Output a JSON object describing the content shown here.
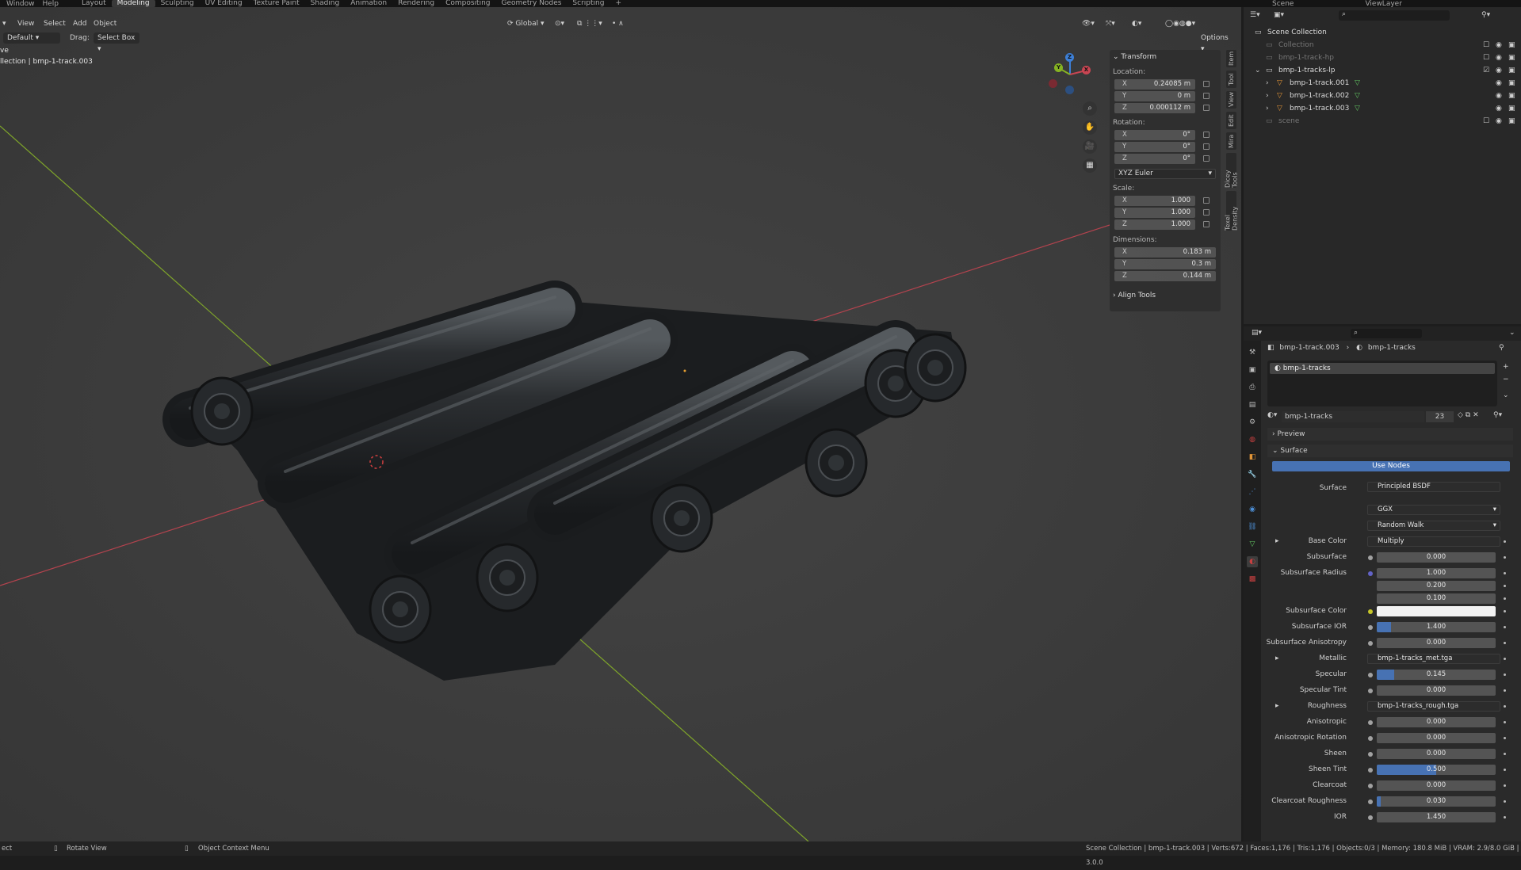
{
  "topbar": {
    "menu": [
      "Window",
      "Help"
    ],
    "workspaces": [
      "Layout",
      "Modeling",
      "Sculpting",
      "UV Editing",
      "Texture Paint",
      "Shading",
      "Animation",
      "Rendering",
      "Compositing",
      "Geometry Nodes",
      "Scripting",
      "+"
    ],
    "active_workspace": "Modeling",
    "scene": "Scene",
    "view_layer": "ViewLayer"
  },
  "viewport": {
    "menus": [
      "View",
      "Select",
      "Add",
      "Object"
    ],
    "mode": "Default",
    "drag_label": "Drag:",
    "drag_value": "Select Box",
    "orientation": "Global",
    "options_label": "Options",
    "overlay_line1": "ve",
    "overlay_line2": "llection | bmp-1-track.003",
    "gizmo": {
      "x": "X",
      "y": "Y",
      "z": "Z"
    }
  },
  "npanel": {
    "transform_title": "Transform",
    "location_label": "Location:",
    "location": {
      "x": "0.24085 m",
      "y": "0 m",
      "z": "0.000112 m"
    },
    "rotation_label": "Rotation:",
    "rotation": {
      "x": "0°",
      "y": "0°",
      "z": "0°"
    },
    "rotation_mode": "XYZ Euler",
    "scale_label": "Scale:",
    "scale": {
      "x": "1.000",
      "y": "1.000",
      "z": "1.000"
    },
    "dimensions_label": "Dimensions:",
    "dimensions": {
      "x": "0.183 m",
      "y": "0.3 m",
      "z": "0.144 m"
    },
    "align_tools": "Align Tools",
    "tabs": [
      "Item",
      "Tool",
      "View",
      "Edit",
      "Mira",
      "Dicey Tools",
      "Texel Density"
    ]
  },
  "outliner": {
    "root": "Scene Collection",
    "rows": [
      {
        "label": "Collection",
        "indent": 1,
        "dim": true
      },
      {
        "label": "bmp-1-track-hp",
        "indent": 1,
        "dim": true
      },
      {
        "label": "bmp-1-tracks-lp",
        "indent": 1,
        "dim": false
      },
      {
        "label": "bmp-1-track.001",
        "indent": 2,
        "dim": false
      },
      {
        "label": "bmp-1-track.002",
        "indent": 2,
        "dim": false
      },
      {
        "label": "bmp-1-track.003",
        "indent": 2,
        "dim": false
      },
      {
        "label": "scene",
        "indent": 1,
        "dim": true
      }
    ]
  },
  "properties": {
    "breadcrumb_object": "bmp-1-track.003",
    "breadcrumb_material": "bmp-1-tracks",
    "slot_name": "bmp-1-tracks",
    "material_name": "bmp-1-tracks",
    "user_count": "23",
    "preview_label": "Preview",
    "surface_panel": "Surface",
    "use_nodes": "Use Nodes",
    "surface_label": "Surface",
    "surface_value": "Principled BSDF",
    "distribution": "GGX",
    "subsurface_method": "Random Walk",
    "rows": [
      {
        "label": "Base Color",
        "type": "link",
        "value": "Multiply",
        "dot": "#c7c729",
        "expand": true
      },
      {
        "label": "Subsurface",
        "type": "num",
        "value": "0.000",
        "fill": 0,
        "dot": "#a1a1a1"
      },
      {
        "label": "Subsurface Radius",
        "type": "num",
        "value": "1.000",
        "fill": 0,
        "dot": "#6363c7"
      },
      {
        "label": "",
        "type": "num",
        "value": "0.200",
        "fill": 0,
        "dot": ""
      },
      {
        "label": "",
        "type": "num",
        "value": "0.100",
        "fill": 0,
        "dot": ""
      },
      {
        "label": "Subsurface Color",
        "type": "color",
        "value": "",
        "dot": "#c7c729"
      },
      {
        "label": "Subsurface IOR",
        "type": "num",
        "value": "1.400",
        "fill": 0.12,
        "dot": "#a1a1a1"
      },
      {
        "label": "Subsurface Anisotropy",
        "type": "num",
        "value": "0.000",
        "fill": 0,
        "dot": "#a1a1a1"
      },
      {
        "label": "Metallic",
        "type": "link",
        "value": "bmp-1-tracks_met.tga",
        "dot": "#a1a1a1",
        "expand": true
      },
      {
        "label": "Specular",
        "type": "num",
        "value": "0.145",
        "fill": 0.145,
        "dot": "#a1a1a1"
      },
      {
        "label": "Specular Tint",
        "type": "num",
        "value": "0.000",
        "fill": 0,
        "dot": "#a1a1a1"
      },
      {
        "label": "Roughness",
        "type": "link",
        "value": "bmp-1-tracks_rough.tga",
        "dot": "#a1a1a1",
        "expand": true
      },
      {
        "label": "Anisotropic",
        "type": "num",
        "value": "0.000",
        "fill": 0,
        "dot": "#a1a1a1"
      },
      {
        "label": "Anisotropic Rotation",
        "type": "num",
        "value": "0.000",
        "fill": 0,
        "dot": "#a1a1a1"
      },
      {
        "label": "Sheen",
        "type": "num",
        "value": "0.000",
        "fill": 0,
        "dot": "#a1a1a1"
      },
      {
        "label": "Sheen Tint",
        "type": "num",
        "value": "0.500",
        "fill": 0.5,
        "dot": "#a1a1a1"
      },
      {
        "label": "Clearcoat",
        "type": "num",
        "value": "0.000",
        "fill": 0,
        "dot": "#a1a1a1"
      },
      {
        "label": "Clearcoat Roughness",
        "type": "num",
        "value": "0.030",
        "fill": 0.03,
        "dot": "#a1a1a1"
      },
      {
        "label": "IOR",
        "type": "num",
        "value": "1.450",
        "fill": 0,
        "dot": "#a1a1a1"
      }
    ]
  },
  "status": {
    "left": "ect",
    "rotate": "Rotate View",
    "context": "Object Context Menu",
    "stats": "Scene Collection | bmp-1-track.003 | Verts:672 | Faces:1,176 | Tris:1,176 | Objects:0/3 | Memory: 180.8 MiB | VRAM: 2.9/8.0 GiB | 3.0.0"
  },
  "colors": {
    "accent": "#4772b3",
    "x_axis": "#c94552",
    "y_axis": "#86b322",
    "z_axis": "#3d7fd6"
  }
}
